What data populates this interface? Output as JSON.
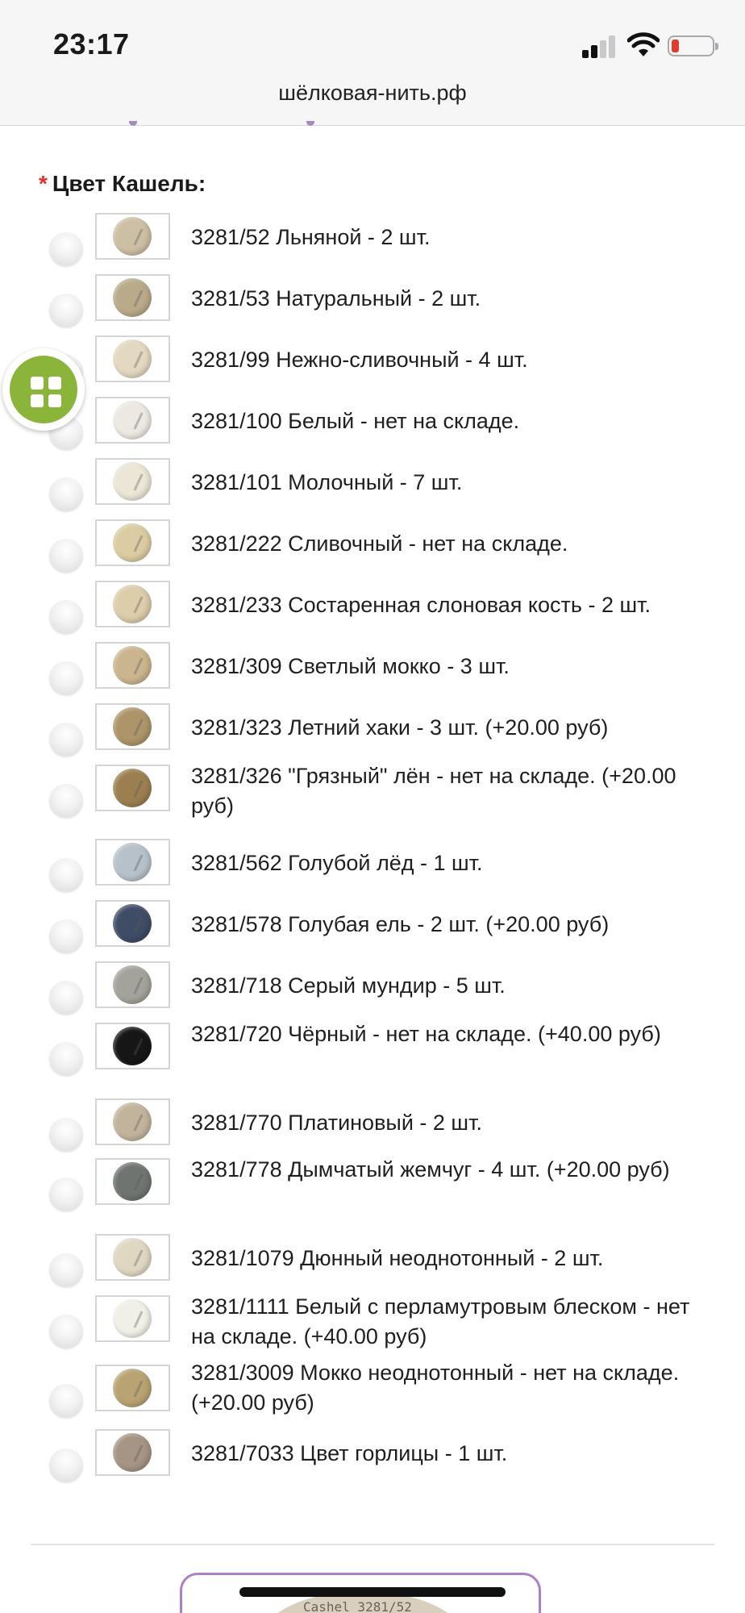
{
  "status_bar": {
    "time": "23:17",
    "battery_color": "#e23b2e"
  },
  "browser": {
    "url": "шёлковая-нить.рф"
  },
  "form": {
    "required_mark": "*",
    "group_label": "Цвет Кашель:",
    "options": [
      {
        "label": "3281/52 Льняной - 2 шт.",
        "swatch": "#cdbfa4"
      },
      {
        "label": "3281/53 Натуральный - 2 шт.",
        "swatch": "#b9aa8a"
      },
      {
        "label": "3281/99 Нежно-сливочный - 4 шт.",
        "swatch": "#e3d8c0"
      },
      {
        "label": "3281/100 Белый - нет на складе.",
        "swatch": "#ebe9e1"
      },
      {
        "label": "3281/101 Молочный - 7 шт.",
        "swatch": "#ebe6d6"
      },
      {
        "label": "3281/222 Сливочный - нет на складе.",
        "swatch": "#dccca3"
      },
      {
        "label": "3281/233 Состаренная слоновая кость - 2 шт.",
        "swatch": "#dccdab"
      },
      {
        "label": "3281/309 Светлый мокко - 3 шт.",
        "swatch": "#cbb58e"
      },
      {
        "label": "3281/323 Летний хаки - 3 шт. (+20.00 руб)",
        "swatch": "#ad9569"
      },
      {
        "label": "3281/326 \"Грязный\" лён - нет на складе. (+20.00 руб)",
        "swatch": "#9b7f50"
      },
      {
        "label": "3281/562 Голубой лёд - 1 шт.",
        "swatch": "#b7c1c9"
      },
      {
        "label": "3281/578 Голубая ель - 2 шт. (+20.00 руб)",
        "swatch": "#3f4c66"
      },
      {
        "label": "3281/718 Серый мундир - 5 шт.",
        "swatch": "#a3a39b"
      },
      {
        "label": "3281/720 Чёрный - нет на складе. (+40.00 руб)",
        "swatch": "#161616"
      },
      {
        "label": "3281/770 Платиновый - 2 шт.",
        "swatch": "#c2b49c"
      },
      {
        "label": "3281/778 Дымчатый жемчуг - 4 шт. (+20.00 руб)",
        "swatch": "#6f7471"
      },
      {
        "label": "3281/1079 Дюнный неоднотонный - 2 шт.",
        "swatch": "#e0d7c3"
      },
      {
        "label": "3281/1111 Белый с перламутровым блеском - нет на складе. (+40.00 руб)",
        "swatch": "#f0f0e8"
      },
      {
        "label": "3281/3009 Мокко неоднотонный - нет на складе. (+20.00 руб)",
        "swatch": "#b9a373"
      },
      {
        "label": "3281/7033 Цвет горлицы - 1 шт.",
        "swatch": "#a69484"
      }
    ]
  },
  "preview": {
    "caption": "Cashel 3281/52"
  },
  "colors": {
    "accent_green": "#8bb43a",
    "accent_purple": "#b07ec6",
    "required_red": "#e0312b"
  }
}
